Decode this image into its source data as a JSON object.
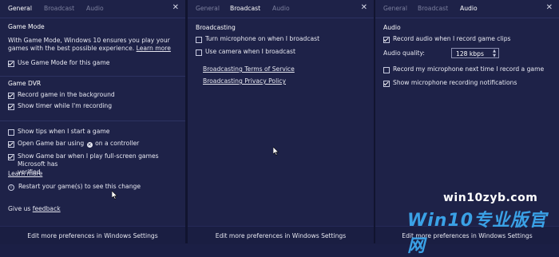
{
  "panels": {
    "general": {
      "tabs": [
        "General",
        "Broadcast",
        "Audio"
      ],
      "game_mode_title": "Game Mode",
      "game_mode_desc_1": "With Game Mode, Windows 10 ensures you play your",
      "game_mode_desc_2": "games with the best possible experience.",
      "learn_more": "Learn more",
      "use_game_mode": "Use Game Mode for this game",
      "game_dvr_title": "Game DVR",
      "record_background": "Record game in the background",
      "show_timer": "Show timer while I'm recording",
      "show_tips": "Show tips when I start a game",
      "open_game_bar_pre": "Open Game bar using",
      "open_game_bar_post": "on a controller",
      "show_fullscreen_1": "Show Game bar when I play full-screen games Microsoft has",
      "show_fullscreen_2": "verified",
      "learn_more_2": "Learn more",
      "restart_note": "Restart your game(s) to see this change",
      "give_us": "Give us",
      "feedback": "feedback",
      "footer": "Edit more preferences in Windows Settings"
    },
    "broadcast": {
      "tabs": [
        "General",
        "Broadcast",
        "Audio"
      ],
      "title": "Broadcasting",
      "mic_on": "Turn microphone on when I broadcast",
      "camera": "Use camera when I broadcast",
      "terms": "Broadcasting Terms of Service",
      "privacy": "Broadcasting Privacy Policy",
      "footer": "Edit more preferences in Windows Settings"
    },
    "audio": {
      "tabs": [
        "General",
        "Broadcast",
        "Audio"
      ],
      "title": "Audio",
      "record_audio": "Record audio when I record game clips",
      "quality_label": "Audio quality:",
      "quality_value": "128 kbps",
      "record_mic": "Record my microphone next time I record a game",
      "show_mic": "Show microphone recording notifications",
      "footer": "Edit more preferences in Windows Settings"
    }
  },
  "watermark": {
    "line1": "win10zyb.com",
    "line2": "Win10专业版官网"
  },
  "colors": {
    "background": "#1e2248",
    "text": "#e6e7f0",
    "inactive_tab": "#7d819f",
    "watermark_blue": "#3aa1e6"
  },
  "icons": {
    "close": "close-icon",
    "checkbox": "checkbox",
    "xbox": "xbox-logo-icon",
    "info": "info-icon",
    "spinner": "spinner-arrows-icon"
  }
}
